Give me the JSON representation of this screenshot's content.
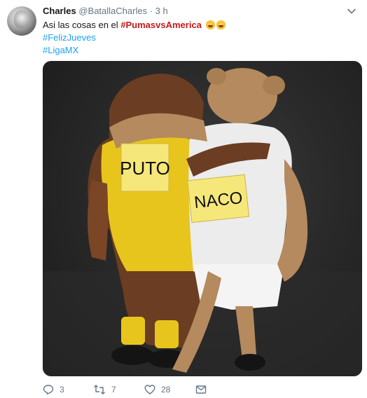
{
  "tweet": {
    "author_name": "Charles",
    "author_handle": "@BatallaCharles",
    "separator": "·",
    "timestamp": "3 h",
    "text_prefix": "Asi las cosas en el ",
    "hashtag_main": "#PumasvsAmerica",
    "hashtag_2": "#FelizJueves",
    "hashtag_3": "#LigaMX",
    "image_signs": {
      "left": "PUTO",
      "right": "NACO"
    }
  },
  "actions": {
    "reply_count": "3",
    "retweet_count": "7",
    "like_count": "28"
  },
  "icons": [
    "avatar",
    "chevron-down-icon",
    "laugh-emoji",
    "reply-icon",
    "retweet-icon",
    "like-icon",
    "message-icon"
  ],
  "colors": {
    "link": "#1da1f2",
    "highlight_hashtag": "#c41a1a",
    "muted": "#657786",
    "text": "#14171a"
  }
}
